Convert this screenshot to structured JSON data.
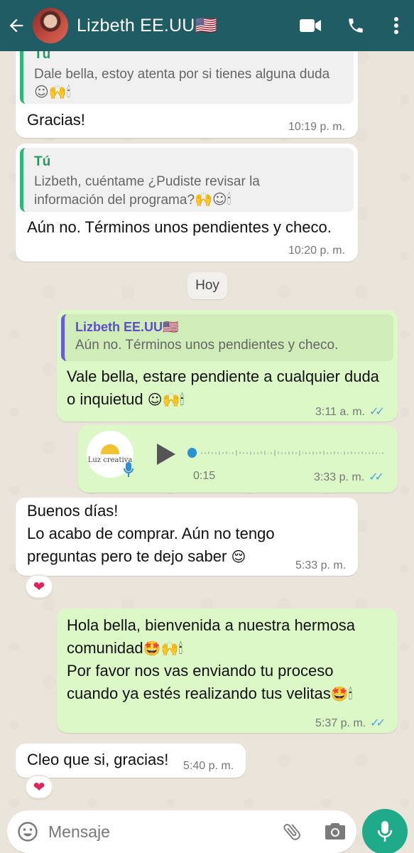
{
  "header": {
    "contact_name": "Lizbeth EE.UU🇺🇸",
    "icons": [
      "back-arrow-icon",
      "avatar",
      "video-call-icon",
      "voice-call-icon",
      "more-options-icon"
    ]
  },
  "messages": [
    {
      "id": "m1",
      "direction": "incoming",
      "quote_author": "Tú",
      "quote_text": "Dale bella, estoy atenta por si tienes alguna duda",
      "quote_emoji": "☺🙌🕯",
      "text": "Gracias!",
      "time": "10:19 p. m."
    },
    {
      "id": "m2",
      "direction": "incoming",
      "quote_author": "Tú",
      "quote_text_line1": "Lizbeth, cuéntame ¿Pudiste revisar la",
      "quote_text_line2": "información del programa?",
      "quote_emoji": "🙌☺🕯",
      "text": "Aún no. Términos unos pendientes y checo.",
      "time": "10:20 p. m."
    },
    {
      "id": "m3",
      "direction": "outgoing",
      "quote_author": "Lizbeth EE.UU🇺🇸",
      "quote_text": "Aún no. Términos unos pendientes y checo.",
      "text_line1": "Vale bella, estare pendiente a cualquier duda",
      "text_line2": "o inquietud",
      "text_emoji": "☺🙌🕯",
      "time": "3:11 a. m.",
      "status": "read"
    },
    {
      "id": "m4",
      "direction": "outgoing",
      "type": "voice",
      "thumb_label": "Luz creativa",
      "duration": "0:15",
      "time": "3:33 p. m.",
      "status": "read"
    },
    {
      "id": "m5",
      "direction": "incoming",
      "text_line1": "Buenos días!",
      "text_line2": "Lo acabo de comprar. Aún no tengo",
      "text_line3": "preguntas pero te dejo saber",
      "text_emoji": "😌",
      "time": "5:33 p. m.",
      "reaction": "❤"
    },
    {
      "id": "m6",
      "direction": "outgoing",
      "text_line1": "Hola bella, bienvenida a nuestra hermosa",
      "text_line2": "comunidad",
      "text_line2_emoji": "🤩🙌🕯",
      "text_line3": "Por favor nos vas enviando tu proceso",
      "text_line4": "cuando ya estés realizando tus velitas",
      "text_line4_emoji": "🤩🕯",
      "time": "5:37 p. m.",
      "status": "read"
    },
    {
      "id": "m7",
      "direction": "incoming",
      "text": "Cleo que si, gracias!",
      "time": "5:40 p. m.",
      "reaction": "❤"
    }
  ],
  "date_separator": "Hoy",
  "read_ticks": "✓✓",
  "composer": {
    "placeholder": "Mensaje"
  },
  "colors": {
    "header": "#1f5c63",
    "outgoing_bubble": "#dcf8c6",
    "incoming_bubble": "#ffffff",
    "read_tick": "#4fa3e0",
    "fab": "#1faa8a"
  }
}
